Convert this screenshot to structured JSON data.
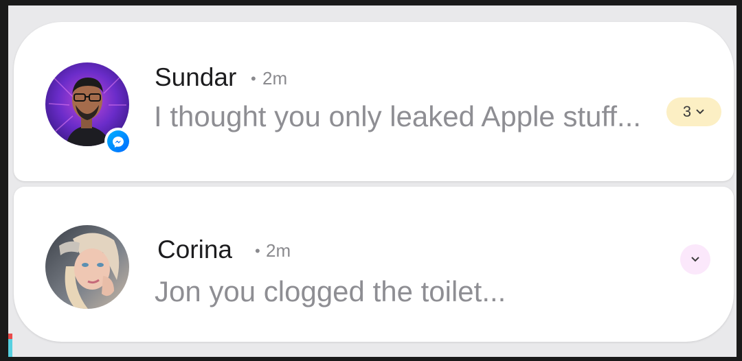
{
  "notifications": [
    {
      "sender": "Sundar",
      "separator": "•",
      "time": "2m",
      "message": "I thought you only leaked Apple stuff...",
      "count": "3",
      "app_badge_icon": "messenger-icon",
      "chip_color": "#fcefc4"
    },
    {
      "sender": "Corina",
      "separator": "•",
      "time": "2m",
      "message": "Jon you clogged the toilet...",
      "expand_color": "#fbe8fb"
    }
  ],
  "colors": {
    "card_bg": "#ffffff",
    "shade_bg": "#e9e9eb",
    "name_text": "#1c1c1e",
    "secondary_text": "#8e8e93",
    "messenger_blue": "#0084ff"
  }
}
